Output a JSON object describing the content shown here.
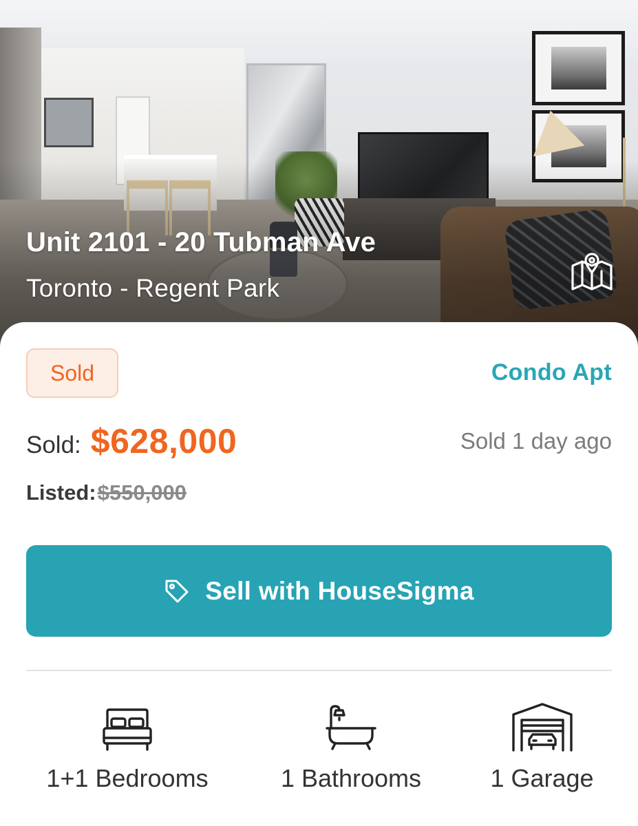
{
  "listing": {
    "title": "Unit 2101 - 20 Tubman Ave",
    "location": "Toronto - Regent Park",
    "status": "Sold",
    "property_type": "Condo Apt",
    "sold_label": "Sold:",
    "sold_price": "$628,000",
    "sold_ago": "Sold 1 day ago",
    "listed_label": "Listed:",
    "listed_price": "$550,000"
  },
  "cta": {
    "label": "Sell with HouseSigma",
    "icon": "tag-icon"
  },
  "features": {
    "bedrooms": "1+1 Bedrooms",
    "bathrooms": "1 Bathrooms",
    "garage": "1 Garage"
  },
  "icons": {
    "map": "map-icon",
    "bed": "bed-icon",
    "bath": "bathtub-icon",
    "garage": "garage-icon"
  },
  "colors": {
    "accent": "#27a3b4",
    "sold_orange": "#f0661f",
    "badge_bg": "#fdeee6",
    "type_teal": "#2aa6b6"
  }
}
